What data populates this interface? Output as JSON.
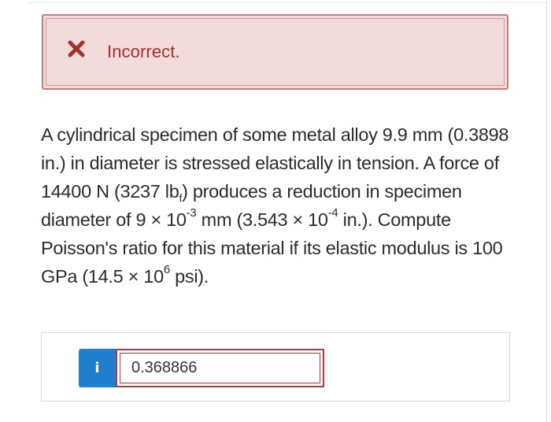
{
  "feedback": {
    "status_text": "Incorrect.",
    "icon": "x-mark-icon",
    "color": "#a0312e",
    "background": "#f4dbdb"
  },
  "question": {
    "text1": "A cylindrical specimen of some metal alloy 9.9 mm (0.3898 in.) in diameter is stressed elastically in tension. A force of 14400 N (3237 lb",
    "sub_f": "f",
    "text2": ") produces a reduction in specimen diameter of 9 × 10",
    "sup_1": "-3",
    "text3": " mm (3.543 × 10",
    "sup_2": "-4",
    "text4": " in.). Compute Poisson's ratio for this material if its elastic modulus is 100 GPa (14.5 × 10",
    "sup_3": "6",
    "text5": " psi)."
  },
  "answer": {
    "info_label": "i",
    "value": "0.368866",
    "input_border_color": "#b73a3a",
    "info_color": "#1f7fcf"
  }
}
